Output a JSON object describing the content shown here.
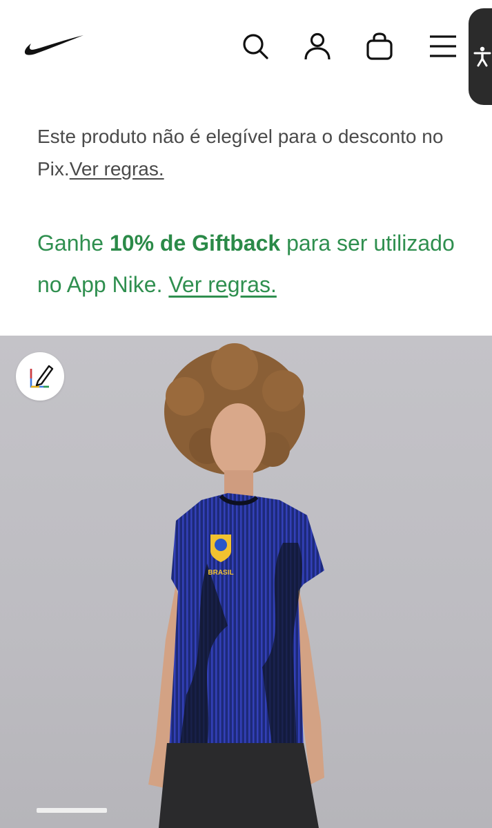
{
  "header": {
    "logo_icon": "nike-swoosh-icon",
    "icons": [
      "search-icon",
      "user-icon",
      "bag-icon",
      "menu-icon"
    ],
    "accessibility_icon": "accessibility-icon"
  },
  "notice": {
    "text": "Este produto não é elegível para o desconto no Pix.",
    "link": "Ver regras."
  },
  "giftback": {
    "prefix": "Ganhe ",
    "bold": "10% de Giftback",
    "suffix": " para ser utilizado no App Nike. ",
    "link": "Ver regras.",
    "color": "#2f8f4f"
  },
  "product_image": {
    "jersey_text": "BRASIL",
    "edit_icon": "edit-note-icon",
    "carousel_progress": 0.14
  }
}
